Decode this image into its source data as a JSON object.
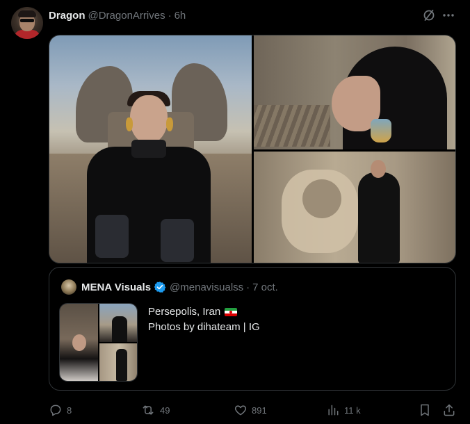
{
  "tweet": {
    "display_name": "Dragon",
    "handle": "@DragonArrives",
    "separator": "·",
    "time": "6h",
    "icons": {
      "grok": "grok-slash-circle-icon",
      "more": "more-dots-icon"
    }
  },
  "quote": {
    "display_name": "MENA Visuals",
    "verified": true,
    "handle": "@menavisualss",
    "separator": "·",
    "date": "7 oct.",
    "text_line1": "Persepolis, Iran",
    "text_line2": "Photos by dihateam | IG",
    "flag_icon": "iran-flag-icon"
  },
  "actions": {
    "reply_count": "8",
    "retweet_count": "49",
    "like_count": "891",
    "views_count": "11 k"
  },
  "colors": {
    "background": "#000000",
    "text_primary": "#e7e9ea",
    "text_secondary": "#71767b",
    "border": "#2f3336",
    "verified": "#1d9bf0"
  }
}
